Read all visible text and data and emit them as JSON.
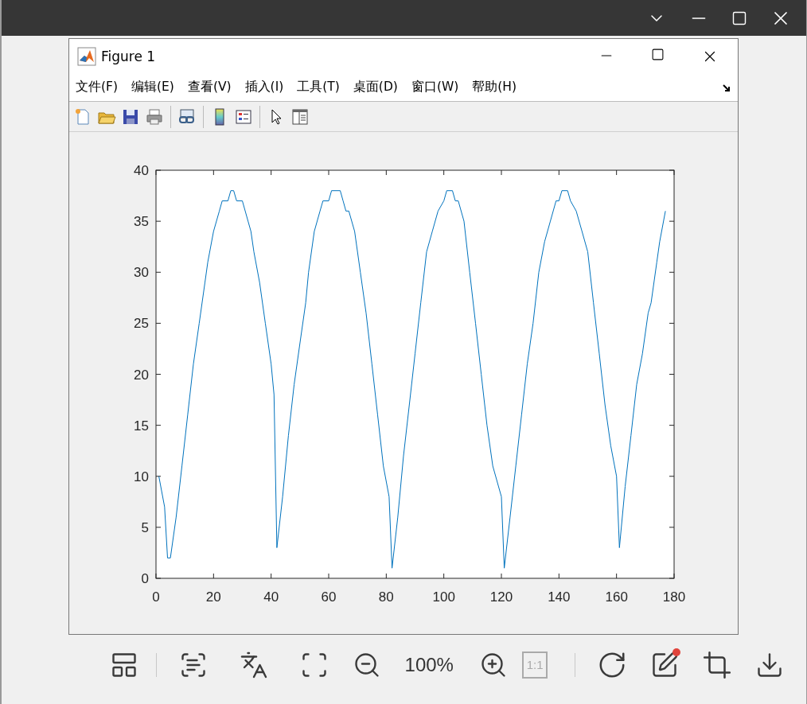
{
  "figure_window": {
    "title": "Figure 1",
    "menu": [
      "文件(F)",
      "编辑(E)",
      "查看(V)",
      "插入(I)",
      "工具(T)",
      "桌面(D)",
      "窗口(W)",
      "帮助(H)"
    ],
    "plot": {
      "chart_data": {
        "type": "line",
        "xlim": [
          0,
          180
        ],
        "ylim": [
          0,
          40
        ],
        "xticks": [
          0,
          20,
          40,
          60,
          80,
          100,
          120,
          140,
          160,
          180
        ],
        "yticks": [
          0,
          5,
          10,
          15,
          20,
          25,
          30,
          35,
          40
        ],
        "x": [
          1,
          3,
          4,
          5,
          7,
          9,
          11,
          13,
          15,
          17,
          18,
          20,
          22,
          23,
          25,
          26,
          27,
          28,
          30,
          32,
          33,
          34,
          36,
          38,
          40,
          41,
          42,
          44,
          46,
          48,
          50,
          52,
          53,
          55,
          57,
          58,
          60,
          61,
          64,
          65,
          66,
          67,
          69,
          71,
          73,
          75,
          77,
          79,
          81,
          82,
          84,
          86,
          88,
          90,
          92,
          94,
          96,
          98,
          100,
          101,
          103,
          104,
          105,
          107,
          109,
          111,
          113,
          115,
          117,
          120,
          121,
          123,
          125,
          127,
          129,
          131,
          133,
          135,
          137,
          139,
          140,
          141,
          143,
          144,
          146,
          148,
          150,
          152,
          154,
          156,
          158,
          160,
          161,
          163,
          165,
          167,
          169,
          171,
          172,
          174,
          175,
          177
        ],
        "series": [
          {
            "color": "#0072bd",
            "values": [
              10,
              7,
              2,
              2,
              6,
              11,
              16,
              21,
              25,
              29,
              31,
              34,
              36,
              37,
              37,
              38,
              38,
              37,
              37,
              35,
              34,
              32,
              29,
              25,
              21,
              18,
              3,
              8,
              14,
              19,
              23,
              27,
              30,
              34,
              36,
              37,
              37,
              38,
              38,
              37,
              36,
              36,
              34,
              30,
              26,
              21,
              16,
              11,
              8,
              1,
              6,
              12,
              17,
              22,
              27,
              32,
              34,
              36,
              37,
              38,
              38,
              37,
              37,
              35,
              30,
              25,
              20,
              15,
              11,
              8,
              1,
              6,
              11,
              16,
              21,
              25,
              30,
              33,
              35,
              37,
              37,
              38,
              38,
              37,
              36,
              34,
              32,
              27,
              22,
              17,
              13,
              10,
              3,
              9,
              14,
              19,
              22,
              26,
              27,
              31,
              33,
              36
            ]
          }
        ]
      }
    }
  },
  "viewer_toolbar": {
    "zoom": "100%",
    "actual_size": {
      "label": "1:1",
      "disabled": true
    },
    "edit_badge": true
  }
}
